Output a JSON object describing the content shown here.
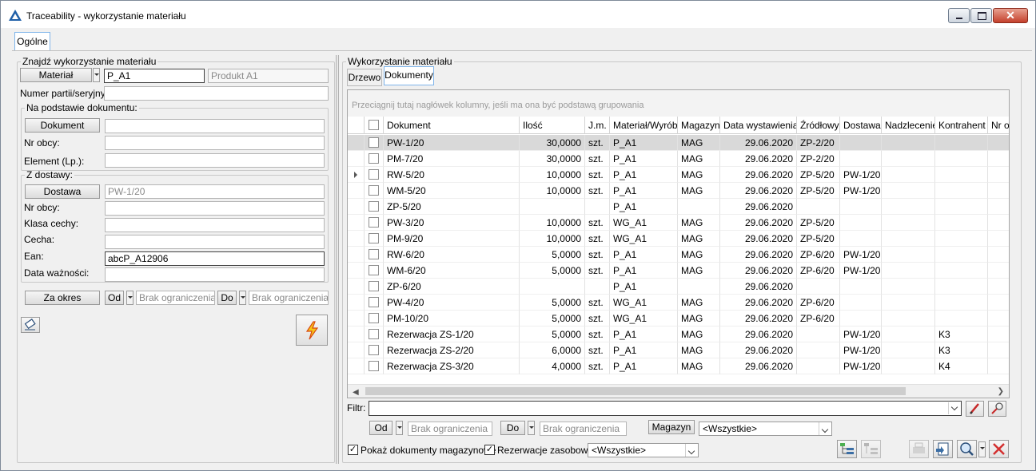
{
  "window": {
    "title": "Traceability - wykorzystanie materiału",
    "top_tab": "Ogólne"
  },
  "left": {
    "find_group": "Znajdź wykorzystanie materiału",
    "material_button": "Materiał",
    "material_code": "P_A1",
    "material_name": "Produkt A1",
    "batch_label": "Numer partii/seryjny:",
    "batch_value": "",
    "doc_group": "Na podstawie dokumentu:",
    "document_button": "Dokument",
    "document_value": "",
    "nr_obcy_label": "Nr obcy:",
    "nr_obcy_value": "",
    "element_label": "Element (Lp.):",
    "element_value": "",
    "delivery_group": "Z dostawy:",
    "delivery_button": "Dostawa",
    "delivery_value": "PW-1/20",
    "d_nr_obcy_label": "Nr obcy:",
    "d_nr_obcy_value": "",
    "klasa_label": "Klasa cechy:",
    "klasa_value": "",
    "cecha_label": "Cecha:",
    "cecha_value": "",
    "ean_label": "Ean:",
    "ean_value": "abcP_A12906",
    "expiry_label": "Data ważności:",
    "expiry_value": "",
    "period_button": "Za okres",
    "from_label": "Od",
    "from_value": "Brak ograniczenia",
    "to_label": "Do",
    "to_value": "Brak ograniczenia"
  },
  "right": {
    "group_title": "Wykorzystanie materiału",
    "tabs": [
      "Drzewo",
      "Dokumenty"
    ],
    "group_hint": "Przeciągnij tutaj nagłówek kolumny, jeśli ma ona być podstawą grupowania",
    "columns": [
      "Dokument",
      "Ilość",
      "J.m.",
      "Materiał/Wyrób",
      "Magazyn",
      "Data wystawienia",
      "Źródłowy",
      "Dostawa",
      "Nadzlecenie",
      "Kontrahent",
      "Nr obcy"
    ],
    "rows": [
      {
        "doc": "PW-1/20",
        "qty": "30,0000",
        "unit": "szt.",
        "mat": "P_A1",
        "mag": "MAG",
        "date": "29.06.2020",
        "src": "ZP-2/20",
        "del": "",
        "nad": "",
        "kon": ""
      },
      {
        "doc": "PM-7/20",
        "qty": "30,0000",
        "unit": "szt.",
        "mat": "P_A1",
        "mag": "MAG",
        "date": "29.06.2020",
        "src": "ZP-2/20",
        "del": "",
        "nad": "",
        "kon": ""
      },
      {
        "doc": "RW-5/20",
        "qty": "10,0000",
        "unit": "szt.",
        "mat": "P_A1",
        "mag": "MAG",
        "date": "29.06.2020",
        "src": "ZP-5/20",
        "del": "PW-1/20",
        "nad": "",
        "kon": ""
      },
      {
        "doc": "WM-5/20",
        "qty": "10,0000",
        "unit": "szt.",
        "mat": "P_A1",
        "mag": "MAG",
        "date": "29.06.2020",
        "src": "ZP-5/20",
        "del": "PW-1/20",
        "nad": "",
        "kon": ""
      },
      {
        "doc": "ZP-5/20",
        "qty": "",
        "unit": "",
        "mat": "P_A1",
        "mag": "",
        "date": "29.06.2020",
        "src": "",
        "del": "",
        "nad": "",
        "kon": ""
      },
      {
        "doc": "PW-3/20",
        "qty": "10,0000",
        "unit": "szt.",
        "mat": "WG_A1",
        "mag": "MAG",
        "date": "29.06.2020",
        "src": "ZP-5/20",
        "del": "",
        "nad": "",
        "kon": ""
      },
      {
        "doc": "PM-9/20",
        "qty": "10,0000",
        "unit": "szt.",
        "mat": "WG_A1",
        "mag": "MAG",
        "date": "29.06.2020",
        "src": "ZP-5/20",
        "del": "",
        "nad": "",
        "kon": ""
      },
      {
        "doc": "RW-6/20",
        "qty": "5,0000",
        "unit": "szt.",
        "mat": "P_A1",
        "mag": "MAG",
        "date": "29.06.2020",
        "src": "ZP-6/20",
        "del": "PW-1/20",
        "nad": "",
        "kon": ""
      },
      {
        "doc": "WM-6/20",
        "qty": "5,0000",
        "unit": "szt.",
        "mat": "P_A1",
        "mag": "MAG",
        "date": "29.06.2020",
        "src": "ZP-6/20",
        "del": "PW-1/20",
        "nad": "",
        "kon": ""
      },
      {
        "doc": "ZP-6/20",
        "qty": "",
        "unit": "",
        "mat": "P_A1",
        "mag": "",
        "date": "29.06.2020",
        "src": "",
        "del": "",
        "nad": "",
        "kon": ""
      },
      {
        "doc": "PW-4/20",
        "qty": "5,0000",
        "unit": "szt.",
        "mat": "WG_A1",
        "mag": "MAG",
        "date": "29.06.2020",
        "src": "ZP-6/20",
        "del": "",
        "nad": "",
        "kon": ""
      },
      {
        "doc": "PM-10/20",
        "qty": "5,0000",
        "unit": "szt.",
        "mat": "WG_A1",
        "mag": "MAG",
        "date": "29.06.2020",
        "src": "ZP-6/20",
        "del": "",
        "nad": "",
        "kon": ""
      },
      {
        "doc": "Rezerwacja ZS-1/20",
        "qty": "5,0000",
        "unit": "szt.",
        "mat": "P_A1",
        "mag": "MAG",
        "date": "29.06.2020",
        "src": "",
        "del": "PW-1/20",
        "nad": "",
        "kon": "K3"
      },
      {
        "doc": "Rezerwacja ZS-2/20",
        "qty": "6,0000",
        "unit": "szt.",
        "mat": "P_A1",
        "mag": "MAG",
        "date": "29.06.2020",
        "src": "",
        "del": "PW-1/20",
        "nad": "",
        "kon": "K3"
      },
      {
        "doc": "Rezerwacja ZS-3/20",
        "qty": "4,0000",
        "unit": "szt.",
        "mat": "P_A1",
        "mag": "MAG",
        "date": "29.06.2020",
        "src": "",
        "del": "PW-1/20",
        "nad": "",
        "kon": "K4"
      }
    ],
    "filter_label": "Filtr:",
    "filter_value": "",
    "from_label": "Od",
    "from_value": "Brak ograniczenia",
    "to_label": "Do",
    "to_value": "Brak ograniczenia",
    "magazyn_button": "Magazyn",
    "magazyn_value": "<Wszystkie>",
    "show_docs_label": "Pokaż dokumenty magazynowe",
    "show_docs_checked": "✓",
    "reservations_label": "Rezerwacje zasobowe",
    "reservations_checked": "✓",
    "reservations_value": "<Wszystkie>"
  }
}
